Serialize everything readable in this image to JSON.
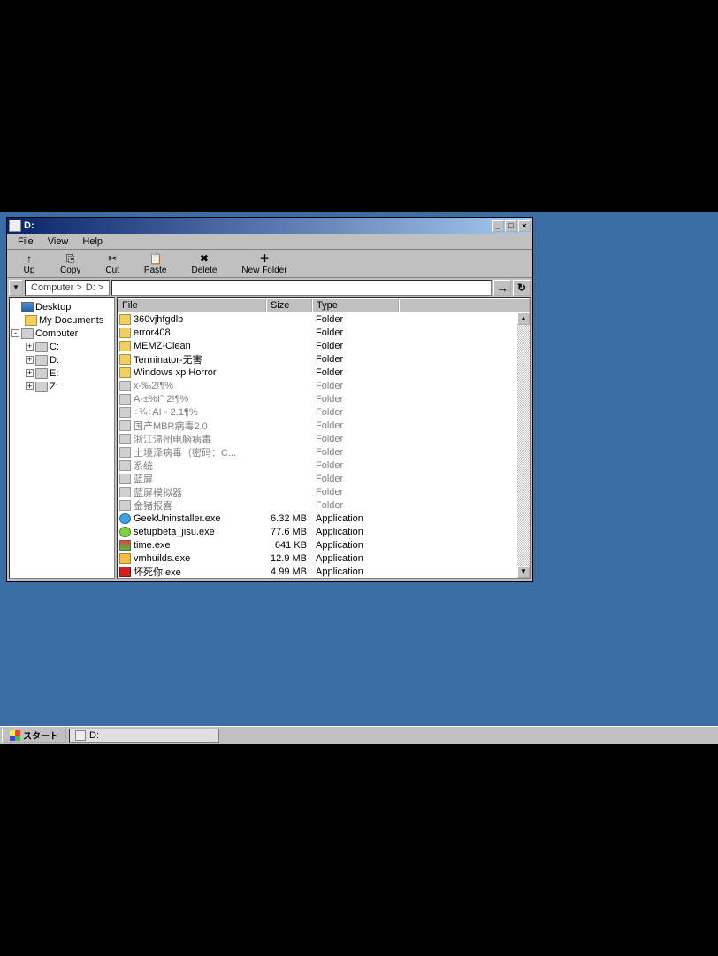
{
  "window": {
    "title": "D:",
    "menu": {
      "file": "File",
      "view": "View",
      "help": "Help"
    },
    "toolbar": {
      "up": "Up",
      "copy": "Copy",
      "cut": "Cut",
      "paste": "Paste",
      "delete": "Delete",
      "newfolder": "New Folder"
    },
    "address": {
      "crumb1": "Computer  >",
      "crumb2": "D:  >"
    }
  },
  "tree": {
    "desktop": "Desktop",
    "mydocs": "My Documents",
    "computer": "Computer",
    "c": "C:",
    "d": "D:",
    "e": "E:",
    "z": "Z:"
  },
  "columns": {
    "file": "File",
    "size": "Size",
    "type": "Type"
  },
  "types": {
    "folder": "Folder",
    "app": "Application"
  },
  "files": [
    {
      "name": "360vjhfgdlb",
      "size": "",
      "type": "folder",
      "icon": "fi-folder"
    },
    {
      "name": "error408",
      "size": "",
      "type": "folder",
      "icon": "fi-folder"
    },
    {
      "name": "MEMZ-Clean",
      "size": "",
      "type": "folder",
      "icon": "fi-folder"
    },
    {
      "name": "Terminator-无害",
      "size": "",
      "type": "folder",
      "icon": "fi-folder"
    },
    {
      "name": "Windows xp Horror",
      "size": "",
      "type": "folder",
      "icon": "fi-folder"
    },
    {
      "name": "x-‰2!¶%",
      "size": "",
      "type": "folder",
      "icon": "fi-folder-gray",
      "gray": true
    },
    {
      "name": "A-±%I° 2!¶%",
      "size": "",
      "type": "folder",
      "icon": "fi-folder-gray",
      "gray": true
    },
    {
      "name": "÷¾÷AI ◦ 2.1¶%",
      "size": "",
      "type": "folder",
      "icon": "fi-folder-gray",
      "gray": true
    },
    {
      "name": "国产MBR病毒2.0",
      "size": "",
      "type": "folder",
      "icon": "fi-folder-gray",
      "gray": true
    },
    {
      "name": "浙江温州电脑病毒",
      "size": "",
      "type": "folder",
      "icon": "fi-folder-gray",
      "gray": true
    },
    {
      "name": "土境泽病毒（密码：C...",
      "size": "",
      "type": "folder",
      "icon": "fi-folder-gray",
      "gray": true
    },
    {
      "name": "系统",
      "size": "",
      "type": "folder",
      "icon": "fi-folder-gray",
      "gray": true
    },
    {
      "name": "蓝屏",
      "size": "",
      "type": "folder",
      "icon": "fi-folder-gray",
      "gray": true
    },
    {
      "name": "蓝屏模拟器",
      "size": "",
      "type": "folder",
      "icon": "fi-folder-gray",
      "gray": true
    },
    {
      "name": "金猪报喜",
      "size": "",
      "type": "folder",
      "icon": "fi-folder-gray",
      "gray": true
    },
    {
      "name": "GeekUninstaller.exe",
      "size": "6.32 MB",
      "type": "app",
      "icon": "fi-app1"
    },
    {
      "name": "setupbeta_jisu.exe",
      "size": "77.6 MB",
      "type": "app",
      "icon": "fi-app2"
    },
    {
      "name": "time.exe",
      "size": "641 KB",
      "type": "app",
      "icon": "fi-app3"
    },
    {
      "name": "vmhuilds.exe",
      "size": "12.9 MB",
      "type": "app",
      "icon": "fi-app4"
    },
    {
      "name": "坏死你.exe",
      "size": "4.99 MB",
      "type": "app",
      "icon": "fi-app5"
    }
  ],
  "taskbar": {
    "start": "スタート",
    "task1": "D:"
  }
}
